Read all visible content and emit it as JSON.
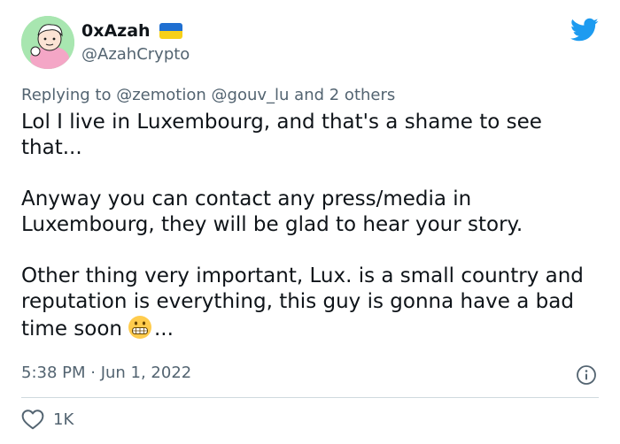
{
  "author": {
    "display_name": "0xAzah",
    "handle": "@AzahCrypto",
    "flag_icon": "ukraine-flag-icon",
    "avatar_bg": "#a8e6b0"
  },
  "reply": {
    "prefix": "Replying to",
    "mentions": [
      "@zemotion",
      "@gouv_lu"
    ],
    "others": "and 2 others"
  },
  "tweet": {
    "paragraphs": [
      "Lol I live in Luxembourg, and that's a shame to see that...",
      "Anyway you can contact any press/media in Luxembourg, they will be glad to hear your story.",
      "Other thing very important, Lux. is a small country and reputation is everything, this guy is gonna have a bad time soon"
    ],
    "ellipsis": "...",
    "emoji": "grimacing-face-emoji"
  },
  "meta": {
    "timestamp": "5:38 PM · Jun 1, 2022"
  },
  "engagement": {
    "likes": "1K"
  },
  "colors": {
    "twitter_blue": "#1d9bf0",
    "muted_text": "#536471",
    "main_text": "#0f1419"
  }
}
